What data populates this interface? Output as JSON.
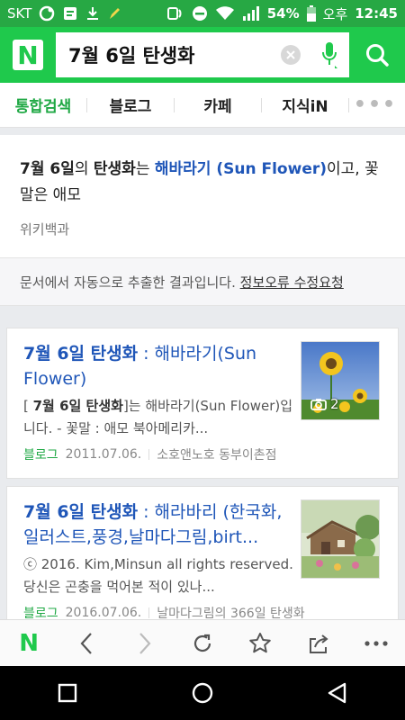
{
  "status_bar": {
    "carrier": "SKT",
    "battery": "54%",
    "ampm": "오후",
    "time": "12:45"
  },
  "search": {
    "query": "7월 6일 탄생화"
  },
  "tabs": [
    {
      "label": "통합검색",
      "active": true
    },
    {
      "label": "블로그"
    },
    {
      "label": "카페"
    },
    {
      "label": "지식iN"
    }
  ],
  "knowledge": {
    "t1": "7월 6일",
    "t2": "의 ",
    "t3": "탄생화",
    "t4": "는 ",
    "t5": "해바라기 (Sun Flower)",
    "t6": "이고, 꽃말은 애모",
    "source": "위키백과",
    "notice_text": "문서에서 자동으로 추출한 결과입니다. ",
    "notice_link": "정보오류 수정요청"
  },
  "results": [
    {
      "title_bold": "7월 6일 탄생화",
      "title_rest": " : 해바라기(Sun Flower)",
      "snippet_pre": "[ ",
      "snippet_bold": "7월 6일 탄생화",
      "snippet_rest": "]는 해바라기(Sun Flower)입니다. - 꽃말 : 애모 북아메리카...",
      "category": "블로그",
      "date": "2011.07.06.",
      "blog": "소호앤노호 동부이촌점",
      "photo_count": "2"
    },
    {
      "title_bold": "7월 6일 탄생화",
      "title_rest": " : 해라바리 (한국화,일러스트,풍경,날마다그림,birt...",
      "snippet_rest": "ⓒ 2016. Kim,Minsun all rights reserved. 당신은 곤충을 먹어본 적이 있나...",
      "category": "블로그",
      "date": "2016.07.06.",
      "blog": "날마다그림의 366일 탄생화"
    }
  ],
  "toolbar": {
    "home_logo": "N"
  },
  "colors": {
    "brand_green": "#1fc94c",
    "link_blue": "#1f56b8"
  }
}
